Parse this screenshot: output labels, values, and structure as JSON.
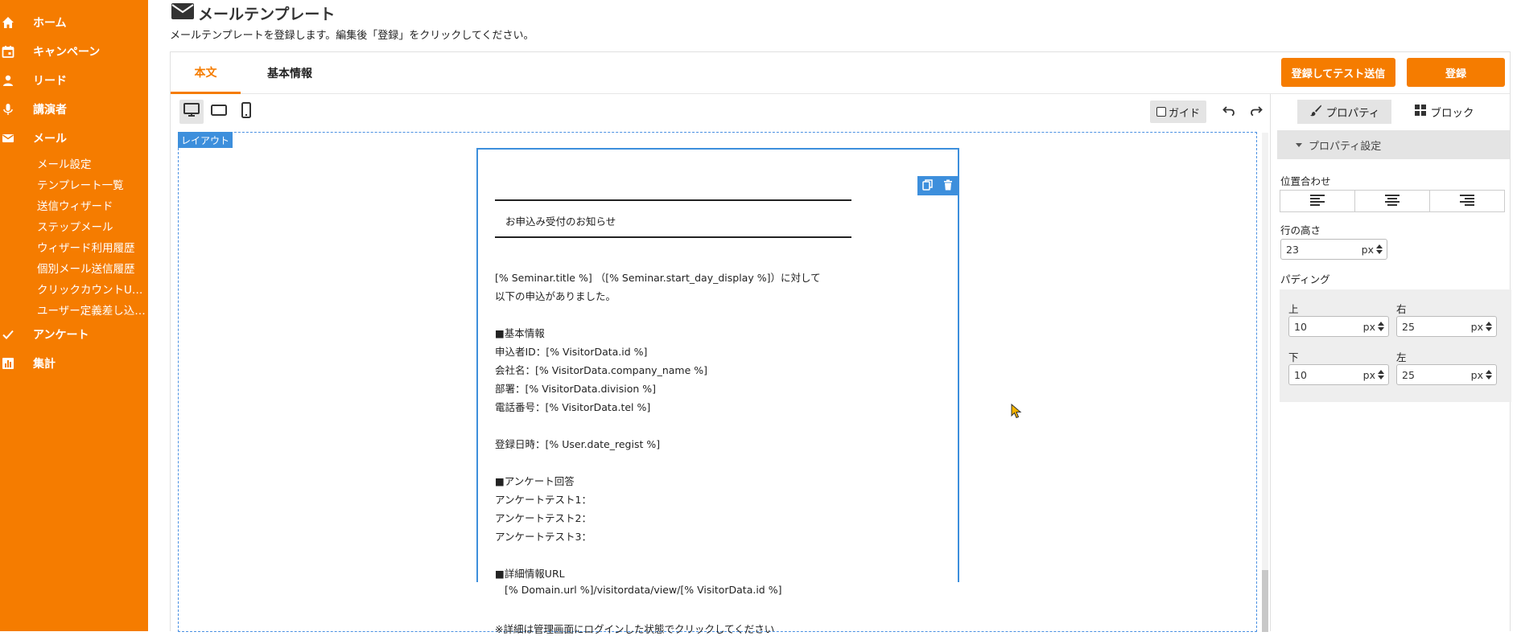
{
  "sidebar": {
    "items": [
      {
        "label": "ホーム",
        "icon": "home-icon"
      },
      {
        "label": "キャンペーン",
        "icon": "calendar-icon"
      },
      {
        "label": "リード",
        "icon": "person-icon"
      },
      {
        "label": "講演者",
        "icon": "microphone-icon"
      },
      {
        "label": "メール",
        "icon": "mail-icon"
      },
      {
        "label": "アンケート",
        "icon": "check-icon"
      },
      {
        "label": "集計",
        "icon": "bar-chart-icon"
      }
    ],
    "mail_submenu": [
      "メール設定",
      "テンプレート一覧",
      "送信ウィザード",
      "ステップメール",
      "ウィザード利用履歴",
      "個別メール送信履歴",
      "クリックカウントU…",
      "ユーザー定義差し込…"
    ]
  },
  "header": {
    "title": "メールテンプレート",
    "description": "メールテンプレートを登録します。編集後「登録」をクリックしてください。"
  },
  "tabs": {
    "body": "本文",
    "basic_info": "基本情報"
  },
  "actions": {
    "register_and_test": "登録してテスト送信",
    "register": "登録"
  },
  "toolbar": {
    "guide_label": "ガイド"
  },
  "canvas": {
    "layout_label": "レイアウト"
  },
  "email": {
    "heading": "お申込み受付のお知らせ",
    "lines": [
      "[% Seminar.title %] （[% Seminar.start_day_display %]）に対して",
      "以下の申込がありました。",
      "■基本情報",
      "申込者ID：[% VisitorData.id %]",
      "会社名：[% VisitorData.company_name %]",
      "部署：[% VisitorData.division %]",
      "電話番号：[% VisitorData.tel %]",
      "登録日時：[% User.date_regist %]",
      "■アンケート回答",
      "アンケートテスト1：",
      "アンケートテスト2：",
      "アンケートテスト3：",
      "■詳細情報URL",
      "[% Domain.url %]/visitordata/view/[% VisitorData.id %]",
      "※詳細は管理画面にログインした状態でクリックしてください"
    ]
  },
  "right_panel": {
    "tab_properties": "プロパティ",
    "tab_blocks": "ブロック",
    "section_title": "プロパティ設定",
    "align_label": "位置合わせ",
    "line_height_label": "行の高さ",
    "line_height_value": "23",
    "unit": "px",
    "padding_label": "パディング",
    "padding": {
      "top_label": "上",
      "top_value": "10",
      "right_label": "右",
      "right_value": "25",
      "bottom_label": "下",
      "bottom_value": "10",
      "left_label": "左",
      "left_value": "25"
    }
  },
  "colors": {
    "accent": "#f57c00",
    "selection": "#3d8fdc"
  }
}
